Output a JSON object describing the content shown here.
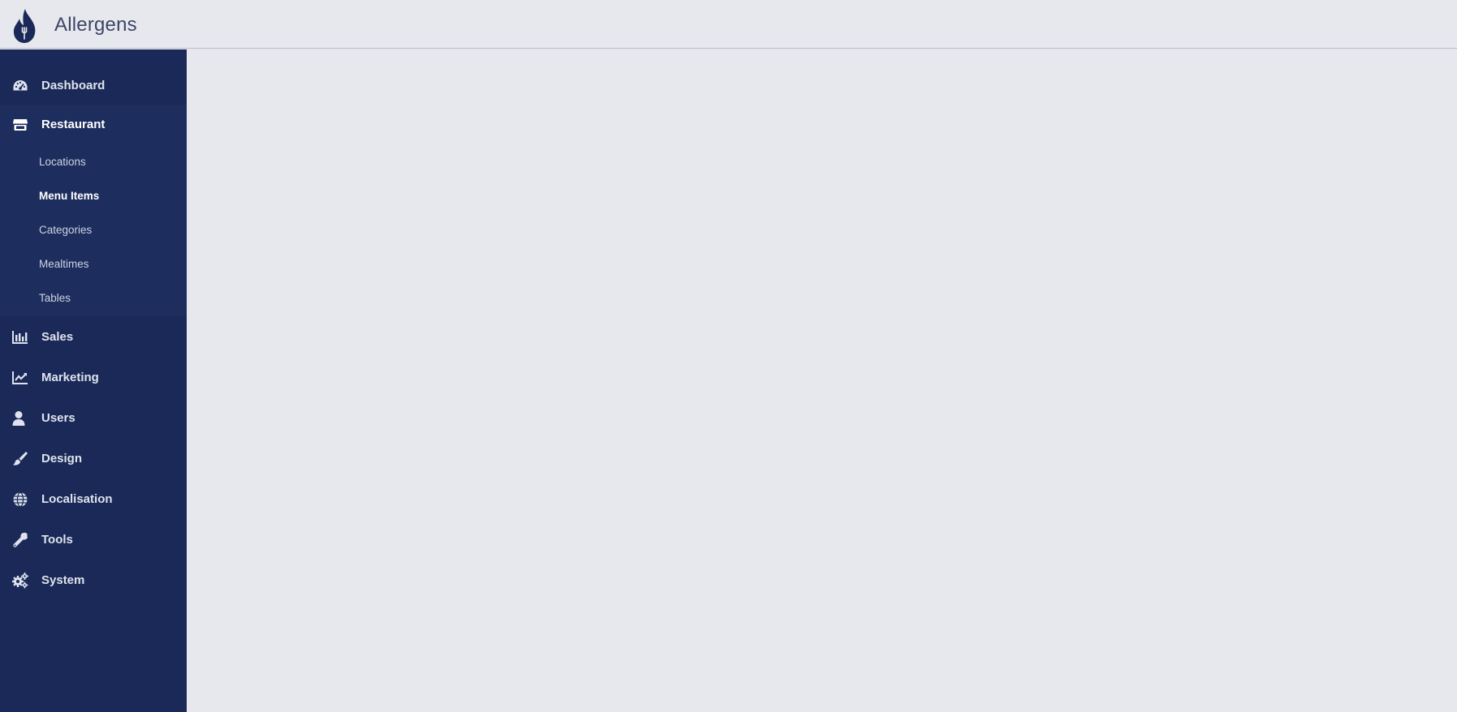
{
  "app": {
    "title": "Allergens"
  },
  "colors": {
    "sidebar_bg": "#1a2957",
    "page_bg": "#e7e8ee",
    "brand": "#1a2957"
  },
  "sidebar": {
    "items": [
      {
        "label": "Dashboard",
        "icon": "gauge-icon"
      },
      {
        "label": "Restaurant",
        "icon": "store-icon",
        "expanded": true
      },
      {
        "label": "Sales",
        "icon": "bar-chart-icon"
      },
      {
        "label": "Marketing",
        "icon": "line-chart-icon"
      },
      {
        "label": "Users",
        "icon": "user-icon"
      },
      {
        "label": "Design",
        "icon": "brush-icon"
      },
      {
        "label": "Localisation",
        "icon": "globe-icon"
      },
      {
        "label": "Tools",
        "icon": "wrench-icon"
      },
      {
        "label": "System",
        "icon": "cogs-icon"
      }
    ],
    "restaurant_submenu": [
      {
        "label": "Locations"
      },
      {
        "label": "Menu Items",
        "selected": true
      },
      {
        "label": "Categories"
      },
      {
        "label": "Mealtimes"
      },
      {
        "label": "Tables"
      }
    ]
  }
}
